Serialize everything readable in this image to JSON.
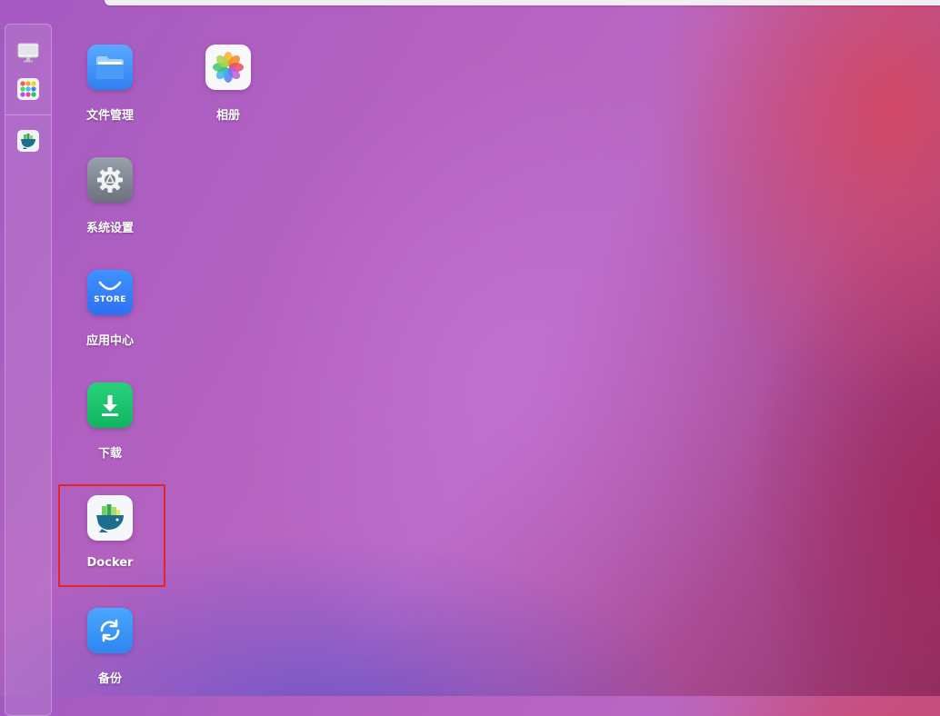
{
  "dock": {
    "items": [
      {
        "name": "desktop",
        "icon": "monitor-icon"
      },
      {
        "name": "app-launcher",
        "icon": "grid-icon"
      },
      {
        "name": "docker",
        "icon": "docker-icon"
      }
    ]
  },
  "desktop": {
    "apps": [
      {
        "label": "文件管理",
        "icon": "folder-icon",
        "color": "#3d8cf5"
      },
      {
        "label": "相册",
        "icon": "photos-icon",
        "color": "#ffffff"
      },
      {
        "label": "系统设置",
        "icon": "gear-icon",
        "color": "#7d8591"
      },
      {
        "label": "应用中心",
        "icon": "store-icon",
        "color": "#2e7cf6",
        "icon_text": "STORE"
      },
      {
        "label": "下载",
        "icon": "download-icon",
        "color": "#19c26b"
      },
      {
        "label": "Docker",
        "icon": "docker-icon",
        "color": "#ffffff"
      },
      {
        "label": "备份",
        "icon": "sync-icon",
        "color": "#2f8ef5"
      }
    ],
    "highlight_color": "#e0262b"
  }
}
